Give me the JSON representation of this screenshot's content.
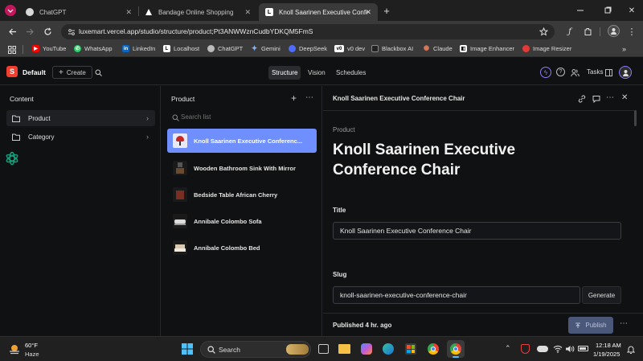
{
  "browser": {
    "tabs": [
      {
        "title": "ChatGPT"
      },
      {
        "title": "Bandage Online Shopping"
      },
      {
        "title": "Knoll Saarinen Executive Confe"
      }
    ],
    "url": "luxemart.vercel.app/studio/structure/product;Pt3ANWWznCudbYDKQM5FmS",
    "bookmarks": [
      "YouTube",
      "WhatsApp",
      "LinkedIn",
      "Localhost",
      "ChatGPT",
      "Gemini",
      "DeepSeek",
      "v0 dev",
      "Blackbox AI",
      "Claude",
      "Image Enhancer",
      "Image Resizer"
    ]
  },
  "studio": {
    "workspace": "Default",
    "create_label": "Create",
    "nav": [
      "Structure",
      "Vision",
      "Schedules"
    ],
    "tasks_label": "Tasks"
  },
  "content_pane": {
    "title": "Content",
    "items": [
      "Product",
      "Category"
    ]
  },
  "product_pane": {
    "title": "Product",
    "search_placeholder": "Search list",
    "items": [
      "Knoll Saarinen Executive Conferenc...",
      "Wooden Bathroom Sink With Mirror",
      "Bedside Table African Cherry",
      "Annibale Colombo Sofa",
      "Annibale Colombo Bed"
    ]
  },
  "document": {
    "header_title": "Knoll Saarinen Executive Conference Chair",
    "type_label": "Product",
    "heading": "Knoll Saarinen Executive Conference Chair",
    "fields": {
      "title_label": "Title",
      "title_value": "Knoll Saarinen Executive Conference Chair",
      "slug_label": "Slug",
      "slug_value": "knoll-saarinen-executive-conference-chair",
      "generate_label": "Generate"
    },
    "status": "Published 4 hr. ago",
    "publish_label": "Publish"
  },
  "taskbar": {
    "weather_temp": "60°F",
    "weather_desc": "Haze",
    "search_label": "Search",
    "time": "12:18 AM",
    "date": "1/19/2025"
  },
  "colors": {
    "accent": "#6f8fff",
    "brand": "#f03e2f"
  }
}
